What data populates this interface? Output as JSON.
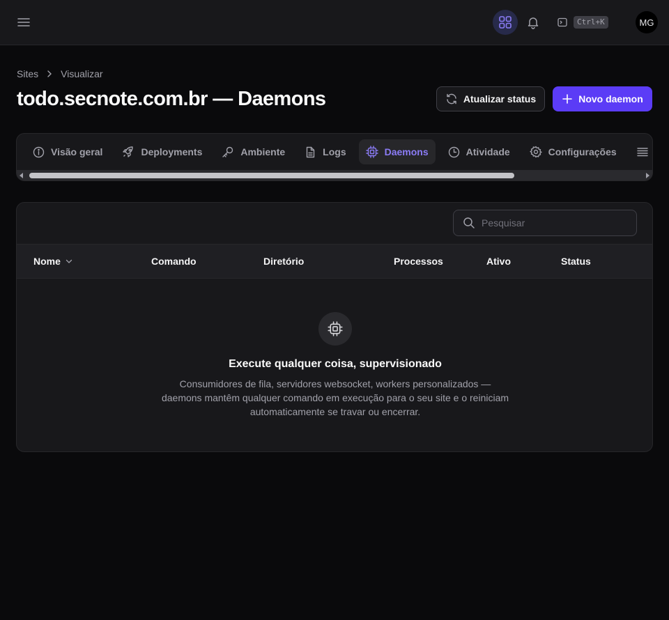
{
  "topbar": {
    "shortcut": "Ctrl+K",
    "avatar_initials": "MG",
    "accent_color": "#8b7cf6"
  },
  "breadcrumb": {
    "items": [
      "Sites",
      "Visualizar"
    ]
  },
  "page": {
    "title": "todo.secnote.com.br — Daemons"
  },
  "actions": {
    "refresh_label": "Atualizar status",
    "new_label": "Novo daemon"
  },
  "tabs": [
    {
      "label": "Visão geral",
      "icon": "info-icon"
    },
    {
      "label": "Deployments",
      "icon": "rocket-icon"
    },
    {
      "label": "Ambiente",
      "icon": "key-icon"
    },
    {
      "label": "Logs",
      "icon": "file-icon"
    },
    {
      "label": "Daemons",
      "icon": "cpu-icon",
      "active": true
    },
    {
      "label": "Atividade",
      "icon": "clock-icon"
    },
    {
      "label": "Configurações",
      "icon": "gear-icon"
    }
  ],
  "search": {
    "placeholder": "Pesquisar",
    "value": ""
  },
  "table": {
    "columns": [
      "Nome",
      "Comando",
      "Diretório",
      "Processos",
      "Ativo",
      "Status"
    ]
  },
  "empty": {
    "title": "Execute qualquer coisa, supervisionado",
    "description": "Consumidores de fila, servidores websocket, workers personalizados — daemons mantêm qualquer comando em execução para o seu site e o reiniciam automaticamente se travar ou encerrar."
  }
}
